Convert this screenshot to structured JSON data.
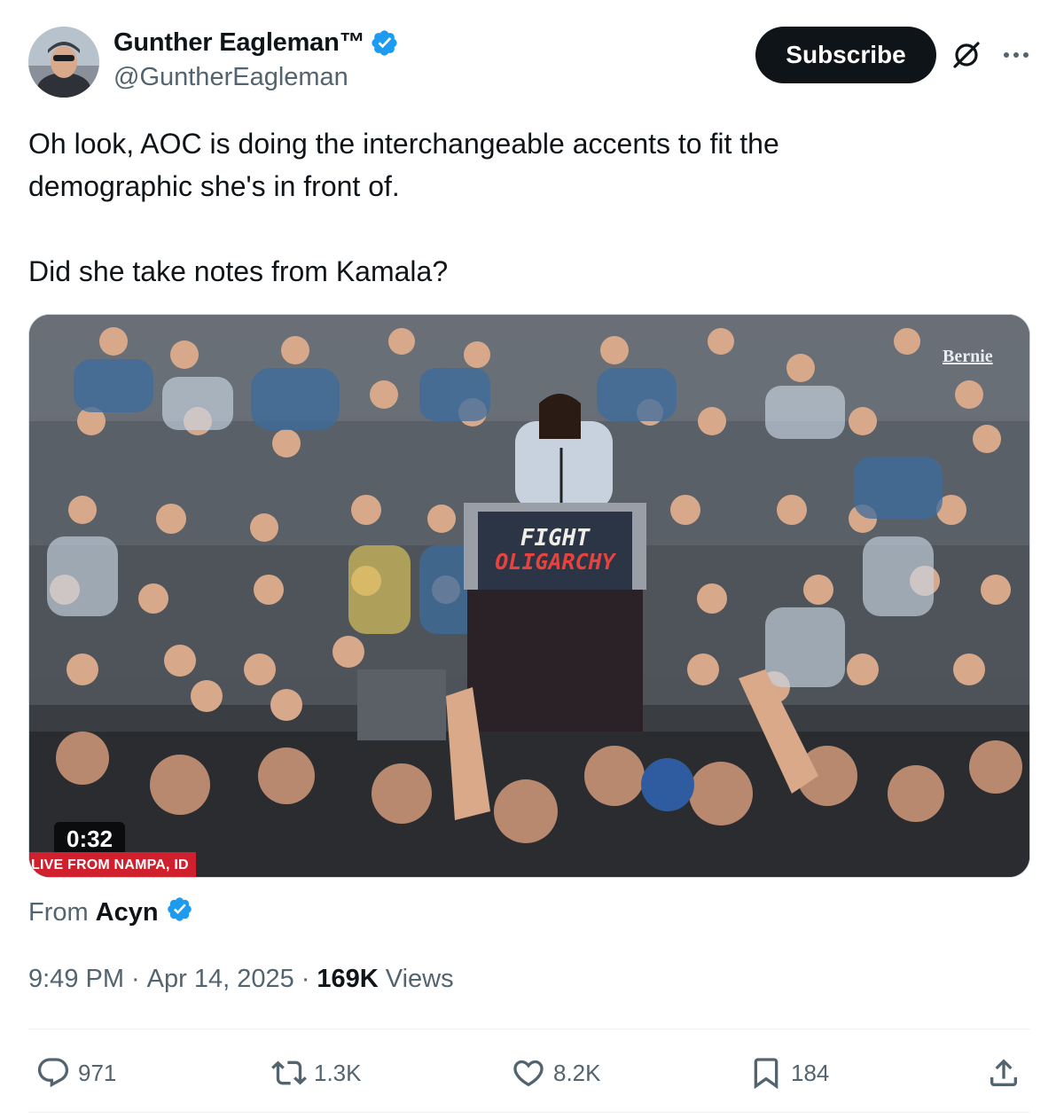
{
  "author": {
    "display_name": "Gunther Eagleman™",
    "handle": "@GuntherEagleman",
    "verified": true
  },
  "header": {
    "subscribe_label": "Subscribe",
    "grok_icon": "grok-icon",
    "more_icon": "more-icon"
  },
  "tweet": {
    "lines": [
      "Oh look, AOC is doing the interchangeable accents to fit the",
      "demographic she's in front of."
    ],
    "question": "Did she take notes from Kamala?"
  },
  "media": {
    "duration": "0:32",
    "chyron": "LIVE FROM NAMPA, ID",
    "watermark": "Bernie",
    "podium_sign_line1": "FIGHT",
    "podium_sign_line2": "OLIGARCHY"
  },
  "source": {
    "prefix": "From",
    "name": "Acyn",
    "verified": true
  },
  "meta": {
    "time": "9:49 PM",
    "separator": "·",
    "date": "Apr 14, 2025",
    "views_count": "169K",
    "views_label": "Views"
  },
  "actions": {
    "replies": "971",
    "reposts": "1.3K",
    "likes": "8.2K",
    "bookmarks": "184"
  },
  "colors": {
    "text_primary": "#0f1419",
    "text_secondary": "#536471",
    "verified_blue": "#1d9bf0",
    "button_dark": "#0f1419",
    "chyron_red": "#d0202d"
  }
}
